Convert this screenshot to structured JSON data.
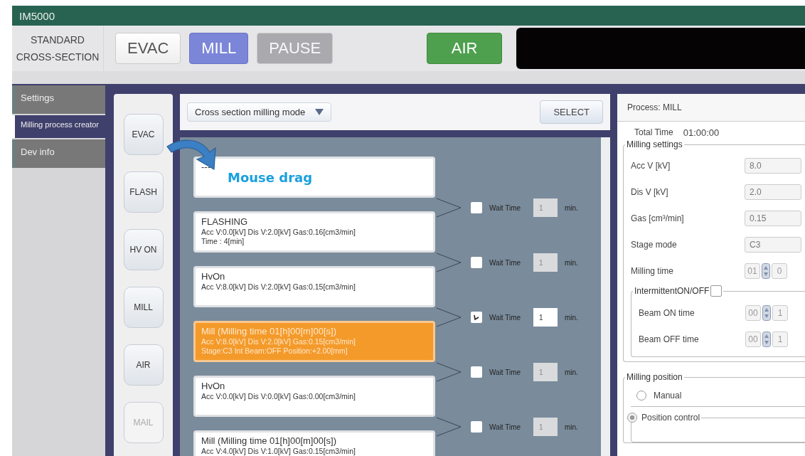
{
  "window": {
    "title": "IM5000"
  },
  "toolbar": {
    "mode": "STANDARD CROSS-SECTION",
    "buttons": [
      {
        "label": "EVAC",
        "kind": "normal"
      },
      {
        "label": "MILL",
        "kind": "active"
      },
      {
        "label": "PAUSE",
        "kind": "disabled"
      },
      {
        "label": "AIR",
        "kind": "air"
      }
    ]
  },
  "sidebar": {
    "items": [
      {
        "label": "Settings",
        "selected": false
      },
      {
        "label": "Milling process creator",
        "selected": true
      },
      {
        "label": "Dev info",
        "selected": false
      }
    ]
  },
  "step_buttons": [
    {
      "label": "EVAC",
      "disabled": false
    },
    {
      "label": "FLASH",
      "disabled": false
    },
    {
      "label": "HV ON",
      "disabled": false
    },
    {
      "label": "MILL",
      "disabled": false
    },
    {
      "label": "AIR",
      "disabled": false
    },
    {
      "label": "MAIL",
      "disabled": true
    }
  ],
  "mode_dropdown": {
    "value": "Cross section milling mode"
  },
  "select_button": "SELECT",
  "steps": [
    {
      "lines": [
        "---"
      ],
      "selected": false
    },
    {
      "lines": [
        "FLASHING",
        "Acc V:0.0[kV]  Dis V:2.0[kV]  Gas:0.16[cm3/min]",
        "Time : 4[min]"
      ],
      "selected": false
    },
    {
      "lines": [
        "HvOn",
        "Acc V:8.0[kV]  Dis V:2.0[kV]  Gas:0.15[cm3/min]"
      ],
      "selected": false
    },
    {
      "lines": [
        "Mill  (Milling time 01[h]00[m]00[s])",
        "Acc V:8.0[kV]  Dis V:2.0[kV]  Gas:0.15[cm3/min]",
        "Stage:C3  Int Beam:OFF Position:+2.00[mm]"
      ],
      "selected": true
    },
    {
      "lines": [
        "HvOn",
        "Acc V:0.0[kV]  Dis V:0.0[kV]  Gas:0.00[cm3/min]"
      ],
      "selected": false
    },
    {
      "lines": [
        "Mill  (Milling time 01[h]00[m]00[s])",
        "Acc V:4.0[kV]  Dis V:1.0[kV]  Gas:0.15[cm3/min]"
      ],
      "selected": false
    }
  ],
  "wait_rows": [
    {
      "label": "Wait Time",
      "value": "1",
      "unit": "min.",
      "checked": false
    },
    {
      "label": "Wait Time",
      "value": "1",
      "unit": "min.",
      "checked": false
    },
    {
      "label": "Wait Time",
      "value": "1",
      "unit": "min.",
      "checked": true
    },
    {
      "label": "Wait Time",
      "value": "1",
      "unit": "min.",
      "checked": false
    },
    {
      "label": "Wait Time",
      "value": "1",
      "unit": "min.",
      "checked": false
    }
  ],
  "annotation": {
    "text": "Mouse drag"
  },
  "process_panel": {
    "header": "Process:  MILL",
    "total_time_label": "Total Time",
    "total_time": "01:00:00",
    "milling_settings": {
      "title": "Milling settings",
      "fields": [
        {
          "label": "Acc V [kV]",
          "kind": "text",
          "value": "8.0"
        },
        {
          "label": "Dis V [kV]",
          "kind": "text",
          "value": "2.0"
        },
        {
          "label": "Gas [cm³/min]",
          "kind": "text",
          "value": "0.15"
        },
        {
          "label": "Stage mode",
          "kind": "text",
          "value": "C3"
        },
        {
          "label": "Milling time",
          "kind": "time",
          "value": "01",
          "value2": "0"
        }
      ]
    },
    "intermittent": {
      "title": "IntermittentON/OFF",
      "checked": false,
      "fields": [
        {
          "label": "Beam ON time",
          "value": "00",
          "value2": "1"
        },
        {
          "label": "Beam OFF time",
          "value": "00",
          "value2": "1"
        }
      ]
    },
    "milling_position": {
      "title": "Milling position",
      "options": [
        {
          "label": "Manual",
          "selected": false
        },
        {
          "label": "Position control",
          "selected": true
        }
      ]
    }
  }
}
